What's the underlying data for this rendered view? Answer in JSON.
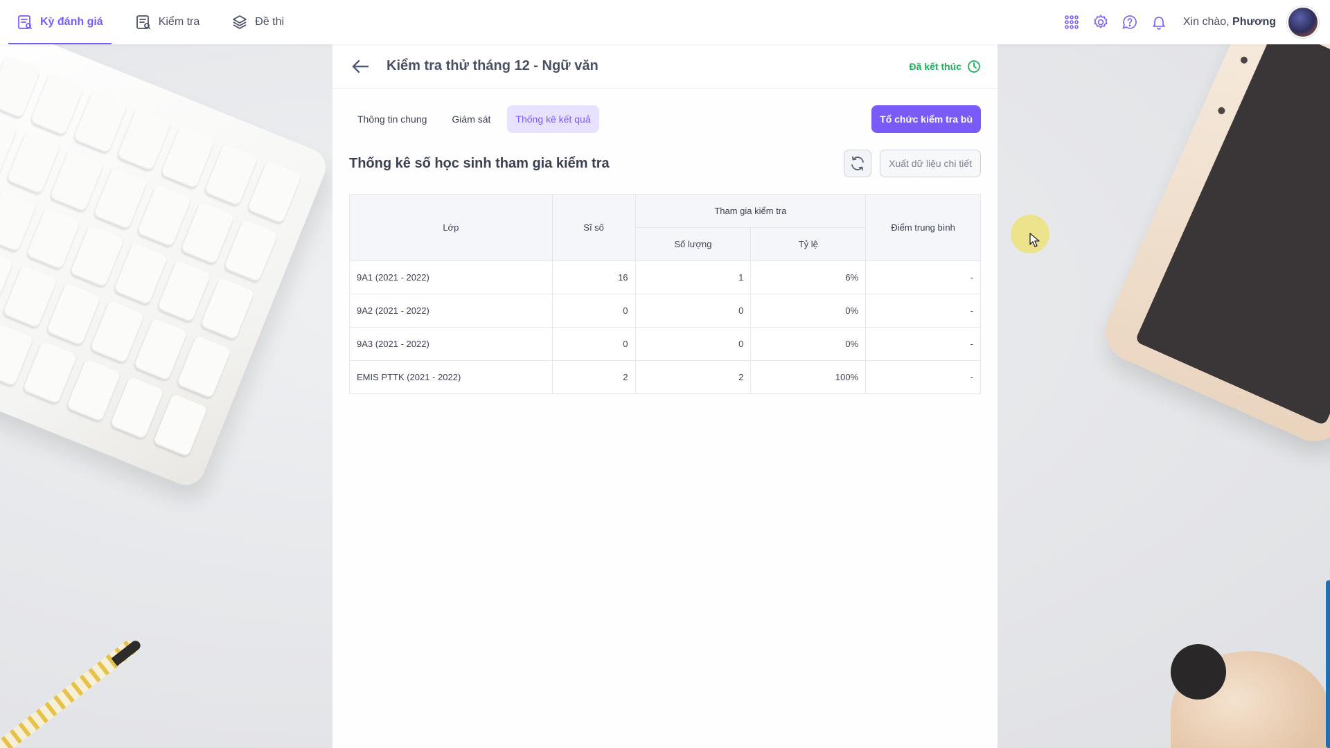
{
  "nav": {
    "items": [
      {
        "label": "Kỳ đánh giá",
        "icon": "clipboard-list-icon",
        "active": true
      },
      {
        "label": "Kiểm tra",
        "icon": "test-sheet-icon",
        "active": false
      },
      {
        "label": "Đề thi",
        "icon": "layers-icon",
        "active": false
      }
    ]
  },
  "topbar": {
    "greeting_prefix": "Xin chào,",
    "user_name": "Phương",
    "icons": [
      "apps-grid-icon",
      "gear-icon",
      "help-icon",
      "bell-icon"
    ]
  },
  "header": {
    "title": "Kiểm tra thử tháng 12 - Ngữ văn",
    "status": "Đã kết thúc",
    "status_color": "#1fae5b"
  },
  "tabs": [
    {
      "label": "Thông tin chung",
      "active": false
    },
    {
      "label": "Giám sát",
      "active": false
    },
    {
      "label": "Thống kê kết quả",
      "active": true
    }
  ],
  "actions": {
    "primary_label": "Tổ chức kiểm tra bù",
    "export_label": "Xuất dữ liệu chi tiết"
  },
  "section": {
    "title": "Thống kê số học sinh tham gia kiểm tra"
  },
  "table": {
    "headers": {
      "lop": "Lớp",
      "si_so": "Sĩ số",
      "tham_gia": "Tham gia kiểm tra",
      "so_luong": "Số lượng",
      "ty_le": "Tỷ lệ",
      "diem_tb": "Điểm trung bình"
    },
    "rows": [
      {
        "lop": "9A1 (2021 - 2022)",
        "si_so": "16",
        "so_luong": "1",
        "ty_le": "6%",
        "diem_tb": "-"
      },
      {
        "lop": "9A2 (2021 - 2022)",
        "si_so": "0",
        "so_luong": "0",
        "ty_le": "0%",
        "diem_tb": "-"
      },
      {
        "lop": "9A3 (2021 - 2022)",
        "si_so": "0",
        "so_luong": "0",
        "ty_le": "0%",
        "diem_tb": "-"
      },
      {
        "lop": "EMIS PTTK (2021 - 2022)",
        "si_so": "2",
        "so_luong": "2",
        "ty_le": "100%",
        "diem_tb": "-"
      }
    ]
  },
  "colors": {
    "accent": "#7a5af8",
    "accent_soft": "#e8e1ff"
  }
}
